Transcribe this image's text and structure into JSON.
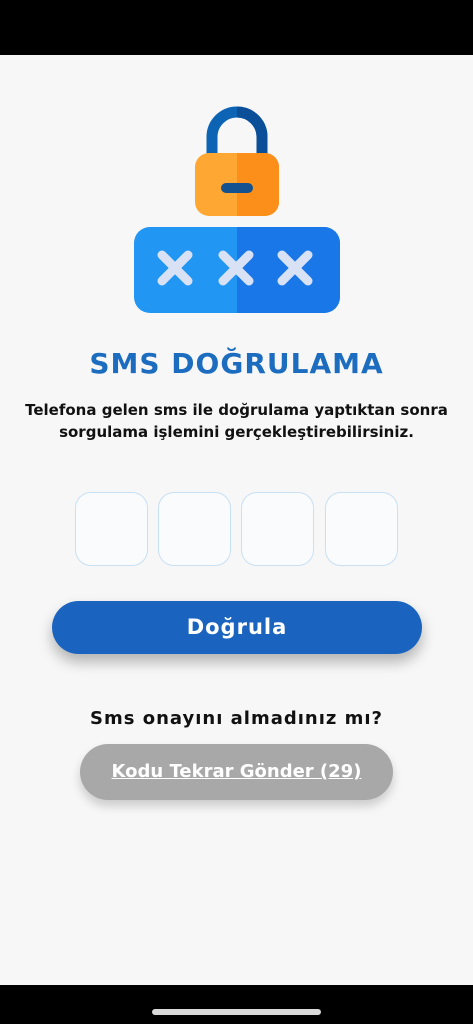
{
  "page": {
    "title": "SMS DOĞRULAMA",
    "description_line1": "Telefona gelen sms ile doğrulama yaptıktan sonra",
    "description_line2": "sorgulama işlemini gerçekleştirebilirsiniz."
  },
  "code_input": {
    "digits": [
      "",
      "",
      "",
      ""
    ]
  },
  "verify_button": {
    "label": "Doğrula"
  },
  "resend": {
    "question": "Sms onayını almadınız mı?",
    "button_label": "Kodu Tekrar Gönder (29)"
  },
  "colors": {
    "primary_blue": "#1a64c0",
    "title_blue": "#1c6cbf",
    "lock_orange": "#ffa733",
    "disabled_gray": "#a8a8a8",
    "background": "#f7f7f7"
  },
  "icons": {
    "illustration": "padlock-with-password-icon"
  }
}
